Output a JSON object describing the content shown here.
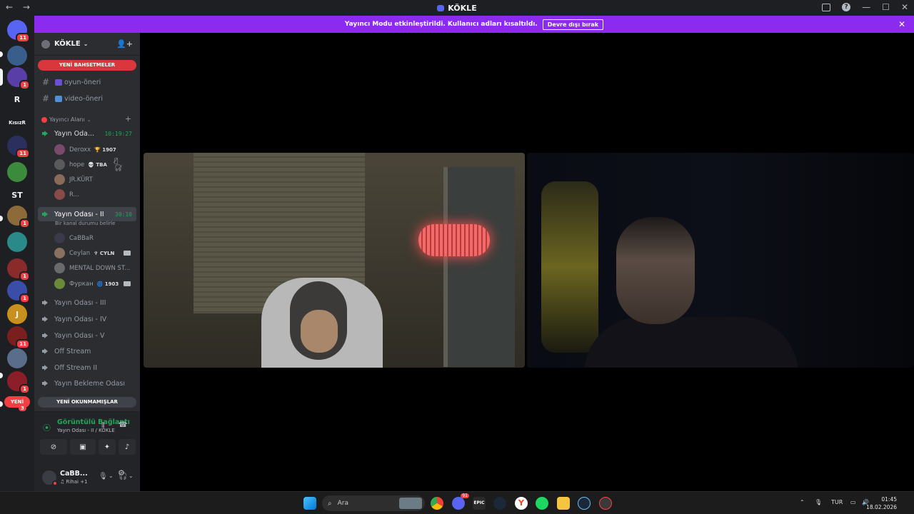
{
  "window": {
    "title": "KÖKLE",
    "back": "←",
    "forward": "→",
    "controls": {
      "minimize": "—",
      "maximize": "☐",
      "close": "✕"
    },
    "help": "?"
  },
  "banner": {
    "message": "Yayıncı Modu etkinleştirildi. Kullanıcı adları kısaltıldı.",
    "disable_label": "Devre dışı bırak",
    "close": "✕"
  },
  "rail": {
    "servers": [
      {
        "label": "",
        "badge": "11",
        "color": "#5865f2"
      },
      {
        "label": "",
        "badge": "",
        "color": "#3a5e8c"
      },
      {
        "label": "",
        "badge": "1",
        "color": "#5a3ea8"
      },
      {
        "label": "R",
        "badge": "",
        "color": "#1e1f22"
      },
      {
        "label": "KısızR",
        "badge": "",
        "color": "#1e1f22"
      },
      {
        "label": "",
        "badge": "11",
        "color": "#2a2f5e"
      },
      {
        "label": "",
        "badge": "",
        "color": "#3c8a3c"
      },
      {
        "label": "ST",
        "badge": "",
        "color": "#1e1f22"
      },
      {
        "label": "",
        "badge": "1",
        "color": "#8c6a3a"
      },
      {
        "label": "",
        "badge": "",
        "color": "#2a8a8a"
      },
      {
        "label": "",
        "badge": "1",
        "color": "#8a2a2a"
      },
      {
        "label": "",
        "badge": "1",
        "color": "#3a4ea8"
      },
      {
        "label": "J",
        "badge": "",
        "color": "#c8901e"
      },
      {
        "label": "",
        "badge": "11",
        "color": "#7a1e1e"
      },
      {
        "label": "",
        "badge": "",
        "color": "#5a6e8c"
      },
      {
        "label": "",
        "badge": "1",
        "color": "#8c1e2a"
      }
    ],
    "new_label": "YENİ",
    "new_badge": "3"
  },
  "sidebar": {
    "guild_name": "KÖKLE",
    "new_mentions": "YENİ BAHSETMELER",
    "text_channels": [
      {
        "name": "oyun-öneri",
        "emoji_color": "#6b4fd8"
      },
      {
        "name": "video-öneri",
        "emoji_color": "#4f8fd8"
      }
    ],
    "category": "Yayıncı Alanı",
    "voice_channels": [
      {
        "name": "Yayın Odası - I",
        "display": "Yayın Oda...",
        "time": "10:19:27"
      },
      {
        "name": "Yayın Odası - II",
        "display": "Yayın Odası - II",
        "time": "30:10",
        "status": "Bir kanal durumu belirle"
      },
      {
        "name": "Yayın Odası - III"
      },
      {
        "name": "Yayın Odası - IV"
      },
      {
        "name": "Yayın Odası - V"
      },
      {
        "name": "Off Stream"
      },
      {
        "name": "Off Stream II"
      },
      {
        "name": "Yayın Bekleme Odası"
      }
    ],
    "room1_users": [
      {
        "name": "Deroxx",
        "tag": "🏆 1907",
        "color": "#7a4a6a"
      },
      {
        "name": "hope",
        "tag": "💀 TBA",
        "extra": "🎙̸ 🎧̸",
        "color": "#5a5a5a"
      },
      {
        "name": "JR.KÜRT",
        "tag": "",
        "color": "#8a6a5a"
      },
      {
        "name": "R...",
        "tag": "",
        "color": "#8a4a4a"
      }
    ],
    "room2_users": [
      {
        "name": "CaBBaR",
        "tag": "",
        "color": "#3a3a4a"
      },
      {
        "name": "Ceylan",
        "tag": "♆ CYLN",
        "cam": true,
        "color": "#8a7060"
      },
      {
        "name": "MENTAL DOWN ST...",
        "tag": "",
        "color": "#6a6a6a"
      },
      {
        "name": "Фуркан",
        "tag": "🌀 1903",
        "cam": true,
        "color": "#6a8a3a"
      }
    ],
    "new_unread": "YENİ OKUNMAMIŞLAR"
  },
  "voice_panel": {
    "title": "Görüntülü Bağlantı",
    "subtitle": "Yayın Odası - II / KÖKLE",
    "buttons": [
      "camera-off",
      "screen-share",
      "activities",
      "soundboard"
    ]
  },
  "user": {
    "name": "CaBB...",
    "status": "♫ Rihai +1"
  },
  "taskbar": {
    "search_placeholder": "Ara",
    "tray_language": "TUR",
    "time": "01:45",
    "date": "18.02.2026",
    "discord_badge": "91"
  },
  "colors": {
    "accent_purple": "#8c2bf0",
    "mention_red": "#da373c",
    "online_green": "#23a55a"
  }
}
